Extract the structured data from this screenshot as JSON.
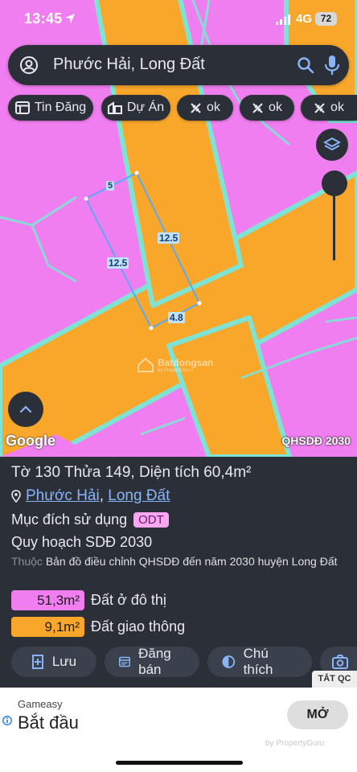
{
  "status": {
    "time": "13:45",
    "network": "4G",
    "battery": "72"
  },
  "search": {
    "query": "Phước Hải, Long Đất"
  },
  "chips": [
    {
      "label": "Tin Đăng",
      "icon": "listing-icon"
    },
    {
      "label": "Dự Án",
      "icon": "building-icon"
    },
    {
      "label": "ok",
      "icon": "tag-icon"
    },
    {
      "label": "ok",
      "icon": "tag-icon"
    },
    {
      "label": "ok",
      "icon": "tag-icon"
    }
  ],
  "map": {
    "parcel_edges": [
      "5",
      "12.5",
      "12.5",
      "4.8"
    ],
    "google_label": "Google",
    "layer_label": "QHSDĐ 2030",
    "watermark": "Batdongsan",
    "watermark_sub": "by PropertyGuru",
    "colors": {
      "residential": "#f07ef0",
      "road": "#f9a72b",
      "border": "#7fe3d4"
    }
  },
  "parcel": {
    "title": "Tờ 130 Thửa 149, Diện tích 60,4m²",
    "ward": "Phước Hải",
    "district": "Long Đất",
    "separator": ",",
    "purpose_label": "Mục đích sử dụng",
    "purpose_code": "ODT",
    "plan_title": "Quy hoạch SDĐ 2030",
    "note_prefix": "Thuộc",
    "note": "Bản đồ điều chỉnh QHSDĐ đến năm 2030 huyện Long Đất",
    "land_uses": [
      {
        "area": "51,3m²",
        "label": "Đất ở đô thị",
        "color": "#f07ef0"
      },
      {
        "area": "9,1m²",
        "label": "Đất giao thông",
        "color": "#f9a72b"
      }
    ]
  },
  "actions": [
    {
      "label": "Lưu",
      "icon": "save-icon"
    },
    {
      "label": "Đăng bán",
      "icon": "calendar-icon"
    },
    {
      "label": "Chú thích",
      "icon": "legend-icon"
    },
    {
      "label": "",
      "icon": "camera-icon"
    }
  ],
  "ad": {
    "close_label": "TẮT QC",
    "brand": "Gameasy",
    "title": "Bắt đầu",
    "cta": "MỞ",
    "watermark": "by PropertyGuru"
  }
}
